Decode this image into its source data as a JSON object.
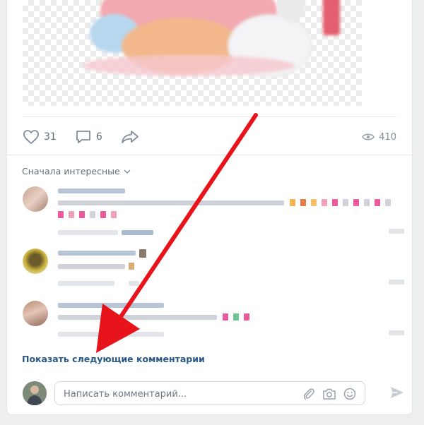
{
  "post": {
    "likes": "31",
    "comments": "6",
    "views": "410"
  },
  "comments_section": {
    "sort_label": "Сначала интересные",
    "show_next_label": "Показать следующие комментарии"
  },
  "composer": {
    "placeholder": "Написать комментарий..."
  },
  "colors": {
    "link": "#2a5885",
    "annotation_arrow": "#e8141b",
    "icon_gray": "#818c99"
  }
}
